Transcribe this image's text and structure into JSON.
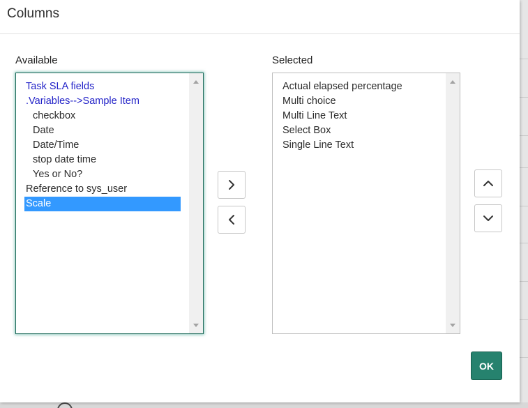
{
  "dialog": {
    "title": "Columns",
    "ok_label": "OK"
  },
  "available": {
    "label": "Available",
    "items": [
      {
        "text": "Task SLA fields",
        "kind": "group"
      },
      {
        "text": ".Variables-->Sample Item",
        "kind": "group"
      },
      {
        "text": "checkbox",
        "kind": "child"
      },
      {
        "text": "Date",
        "kind": "child"
      },
      {
        "text": "Date/Time",
        "kind": "child"
      },
      {
        "text": "stop date time",
        "kind": "child"
      },
      {
        "text": "Yes or No?",
        "kind": "child"
      },
      {
        "text": "Reference to sys_user",
        "kind": "plain"
      },
      {
        "text": "Scale",
        "kind": "highlight"
      }
    ]
  },
  "selected": {
    "label": "Selected",
    "items": [
      "Actual elapsed percentage",
      "Multi choice",
      "Multi Line Text",
      "Select Box",
      "Single Line Text"
    ]
  },
  "icons": {
    "move_right": "chevron-right-icon",
    "move_left": "chevron-left-icon",
    "move_up": "chevron-up-icon",
    "move_down": "chevron-down-icon"
  },
  "colors": {
    "group_text": "#2323c8",
    "highlight": "#3399ff",
    "ok_button": "#26826e",
    "focus_ring": "#1e6a5a"
  }
}
